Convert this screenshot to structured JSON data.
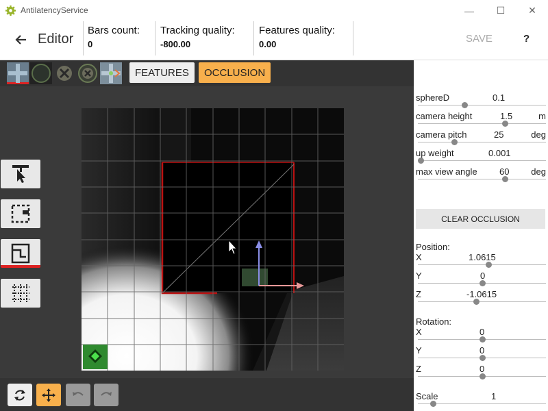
{
  "window": {
    "title": "AntilatencyService",
    "minimize": "—",
    "maximize": "☐",
    "close": "✕"
  },
  "header": {
    "title": "Editor",
    "stats": [
      {
        "label": "Bars count:",
        "value": "0"
      },
      {
        "label": "Tracking quality:",
        "value": "-800.00"
      },
      {
        "label": "Features quality:",
        "value": "0.00"
      }
    ],
    "save_label": "SAVE",
    "help_label": "?"
  },
  "toolbar": {
    "tabs": [
      {
        "label": "FEATURES",
        "active": false
      },
      {
        "label": "OCCLUSION",
        "active": true
      }
    ],
    "accent": "#f8b04c"
  },
  "params": [
    {
      "label": "sphereD",
      "value": "0.1",
      "unit": "",
      "level": 0.35
    },
    {
      "label": "camera height",
      "value": "1.5",
      "unit": "m",
      "level": 0.67
    },
    {
      "label": "camera pitch",
      "value": "25",
      "unit": "deg",
      "level": 0.27
    },
    {
      "label": "up weight",
      "value": "0.001",
      "unit": "",
      "level": 0.0
    },
    {
      "label": "max view angle",
      "value": "60",
      "unit": "deg",
      "level": 0.67
    }
  ],
  "clear_occlusion_label": "CLEAR OCCLUSION",
  "position": {
    "title": "Position:",
    "axes": [
      {
        "label": "X",
        "value": "1.0615",
        "level": 0.54
      },
      {
        "label": "Y",
        "value": "0",
        "level": 0.49
      },
      {
        "label": "Z",
        "value": "-1.0615",
        "level": 0.44
      }
    ]
  },
  "rotation": {
    "title": "Rotation:",
    "axes": [
      {
        "label": "X",
        "value": "0",
        "level": 0.49
      },
      {
        "label": "Y",
        "value": "0",
        "level": 0.49
      },
      {
        "label": "Z",
        "value": "0",
        "level": 0.49
      }
    ]
  },
  "scale": {
    "label": "Scale",
    "value": "1",
    "level": 0.1
  }
}
